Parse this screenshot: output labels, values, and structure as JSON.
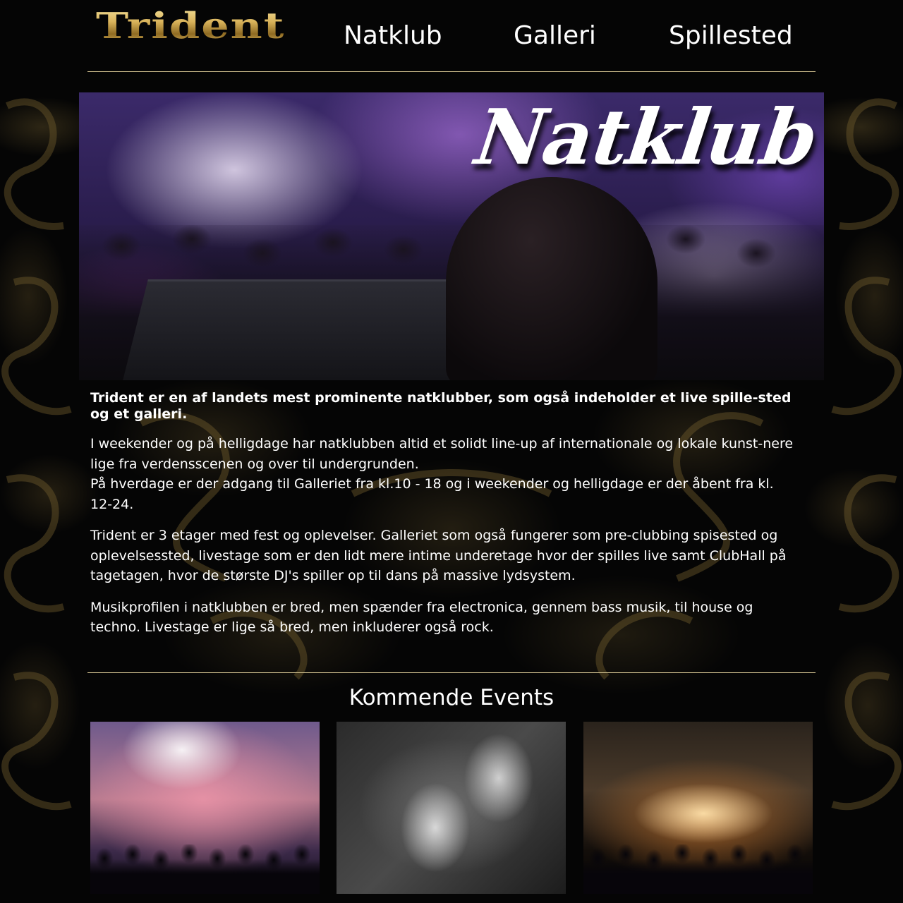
{
  "brand": {
    "logo_text": "Trident"
  },
  "nav": {
    "items": [
      {
        "label": "Natklub"
      },
      {
        "label": "Galleri"
      },
      {
        "label": "Spillested"
      }
    ]
  },
  "hero": {
    "title": "Natklub"
  },
  "content": {
    "lead": "Trident er en af landets mest prominente natklubber, som også indeholder et live spille-sted og et galleri.",
    "paragraph_1_line_1": "I weekender og på helligdage har natklubben altid et solidt line-up af internationale og lokale kunst-nere lige fra verdensscenen og over til undergrunden.",
    "paragraph_1_line_2": "På hverdage er der adgang til Galleriet fra kl.10 - 18 og i weekender og helligdage er der åbent fra kl. 12-24.",
    "paragraph_2": "Trident er 3 etager med fest og oplevelser. Galleriet som også fungerer som pre-clubbing spisested og oplevelsessted, livestage som er den lidt mere intime underetage hvor der spilles live samt ClubHall på tagetagen, hvor de største DJ's spiller op til dans på massive lydsystem.",
    "paragraph_3": "Musikprofilen i natklubben er bred, men spænder fra electronica, gennem bass musik, til house og techno. Livestage er lige så bred, men inkluderer også rock."
  },
  "events": {
    "heading": "Kommende Events"
  },
  "colors": {
    "background": "#000000",
    "divider": "#c9b98a",
    "logo_gold": "#d9b35a",
    "text": "#ffffff"
  }
}
